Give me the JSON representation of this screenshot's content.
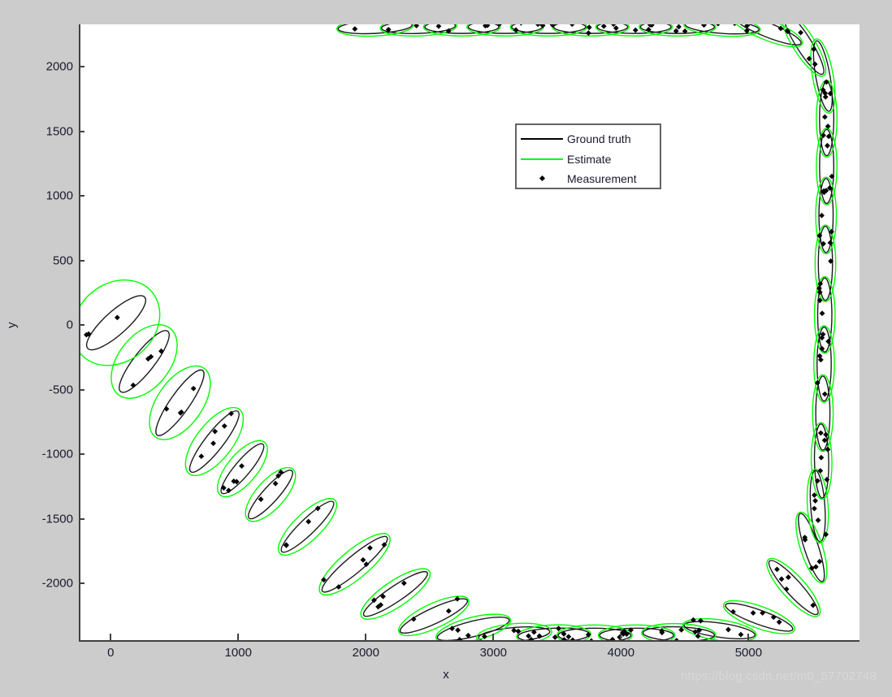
{
  "figure": {
    "background_color": "#cccccc",
    "plot_background_color": "#ffffff",
    "axis_color": "#404040"
  },
  "axes": {
    "xlabel": "x",
    "ylabel": "y",
    "xticks": [
      "0",
      "1000",
      "2000",
      "3000",
      "4000",
      "5000"
    ],
    "yticks": [
      "2000",
      "1500",
      "1000",
      "500",
      "0",
      "-500",
      "-1000",
      "-1500",
      "-2000"
    ]
  },
  "legend": {
    "items": [
      {
        "label": "Ground truth",
        "type": "line",
        "color": "#000000"
      },
      {
        "label": "Estimate",
        "type": "line",
        "color": "#00ff00"
      },
      {
        "label": "Measurement",
        "type": "marker",
        "color": "#000000"
      }
    ]
  },
  "watermark": {
    "text": "https://blog.csdn.net/m0_57702748"
  },
  "chart_data": {
    "type": "scatter",
    "title": "",
    "xlabel": "x",
    "ylabel": "y",
    "xlim": [
      -250,
      5870
    ],
    "ylim": [
      -2450,
      2330
    ],
    "xticks": [
      0,
      1000,
      2000,
      3000,
      4000,
      5000
    ],
    "yticks": [
      2000,
      1500,
      1000,
      500,
      0,
      -500,
      -1000,
      -1500,
      -2000
    ],
    "grid": false,
    "legend_position": "upper-center",
    "series": [
      {
        "name": "Ground truth",
        "color": "#000000",
        "render": "covariance-ellipse"
      },
      {
        "name": "Estimate",
        "color": "#00ff00",
        "render": "covariance-ellipse"
      },
      {
        "name": "Measurement",
        "color": "#000000",
        "render": "diamond-marker"
      }
    ],
    "description": "Rounded-rectangle target trajectory traversed counter-clockwise from upper-left start, down the left diagonal, along the bottom to the right, then up the right side and across the top. Each time step draws a black ground-truth covariance ellipse, a green estimate covariance ellipse, and clustered black diamond measurement points.",
    "steps": [
      {
        "i": 0,
        "x": 30,
        "y": 20,
        "truth_rx": 300,
        "truth_ry": 90,
        "est_rx": 370,
        "est_ry": 300,
        "angle": 42,
        "n_meas": 3
      },
      {
        "i": 1,
        "x": 250,
        "y": -280,
        "truth_rx": 300,
        "truth_ry": 80,
        "est_rx": 330,
        "est_ry": 200,
        "angle": 52,
        "n_meas": 4
      },
      {
        "i": 2,
        "x": 530,
        "y": -600,
        "truth_rx": 310,
        "truth_ry": 75,
        "est_rx": 330,
        "est_ry": 175,
        "angle": 55,
        "n_meas": 4
      },
      {
        "i": 3,
        "x": 800,
        "y": -900,
        "truth_rx": 300,
        "truth_ry": 70,
        "est_rx": 320,
        "est_ry": 140,
        "angle": 52,
        "n_meas": 5
      },
      {
        "i": 4,
        "x": 1020,
        "y": -1110,
        "truth_rx": 250,
        "truth_ry": 60,
        "est_rx": 270,
        "est_ry": 115,
        "angle": 50,
        "n_meas": 5
      },
      {
        "i": 5,
        "x": 1240,
        "y": -1310,
        "truth_rx": 250,
        "truth_ry": 60,
        "est_rx": 265,
        "est_ry": 110,
        "angle": 48,
        "n_meas": 4
      },
      {
        "i": 6,
        "x": 1530,
        "y": -1560,
        "truth_rx": 280,
        "truth_ry": 60,
        "est_rx": 300,
        "est_ry": 105,
        "angle": 44,
        "n_meas": 4
      },
      {
        "i": 7,
        "x": 1900,
        "y": -1850,
        "truth_rx": 330,
        "truth_ry": 65,
        "est_rx": 350,
        "est_ry": 110,
        "angle": 40,
        "n_meas": 6
      },
      {
        "i": 8,
        "x": 2220,
        "y": -2080,
        "truth_rx": 300,
        "truth_ry": 60,
        "est_rx": 320,
        "est_ry": 100,
        "angle": 34,
        "n_meas": 5
      },
      {
        "i": 9,
        "x": 2520,
        "y": -2250,
        "truth_rx": 290,
        "truth_ry": 60,
        "est_rx": 300,
        "est_ry": 95,
        "angle": 25,
        "n_meas": 3
      },
      {
        "i": 10,
        "x": 2830,
        "y": -2350,
        "truth_rx": 290,
        "truth_ry": 60,
        "est_rx": 300,
        "est_ry": 90,
        "angle": 14,
        "n_meas": 5
      },
      {
        "i": 11,
        "x": 3150,
        "y": -2395,
        "truth_rx": 280,
        "truth_ry": 55,
        "est_rx": 295,
        "est_ry": 85,
        "angle": 5,
        "n_meas": 5
      },
      {
        "i": 12,
        "x": 3460,
        "y": -2400,
        "truth_rx": 280,
        "truth_ry": 55,
        "est_rx": 290,
        "est_ry": 80,
        "angle": 2,
        "n_meas": 6
      },
      {
        "i": 13,
        "x": 3780,
        "y": -2400,
        "truth_rx": 285,
        "truth_ry": 55,
        "est_rx": 295,
        "est_ry": 80,
        "angle": 0,
        "n_meas": 6
      },
      {
        "i": 14,
        "x": 4110,
        "y": -2400,
        "truth_rx": 290,
        "truth_ry": 55,
        "est_rx": 300,
        "est_ry": 80,
        "angle": 0,
        "n_meas": 6
      },
      {
        "i": 15,
        "x": 4440,
        "y": -2390,
        "truth_rx": 280,
        "truth_ry": 55,
        "est_rx": 290,
        "est_ry": 80,
        "angle": -2,
        "n_meas": 5
      },
      {
        "i": 16,
        "x": 4760,
        "y": -2360,
        "truth_rx": 280,
        "truth_ry": 55,
        "est_rx": 290,
        "est_ry": 80,
        "angle": -8,
        "n_meas": 5
      },
      {
        "i": 17,
        "x": 5070,
        "y": -2260,
        "truth_rx": 280,
        "truth_ry": 55,
        "est_rx": 295,
        "est_ry": 85,
        "angle": -20,
        "n_meas": 5
      },
      {
        "i": 18,
        "x": 5340,
        "y": -2030,
        "truth_rx": 280,
        "truth_ry": 60,
        "est_rx": 295,
        "est_ry": 90,
        "angle": -48,
        "n_meas": 5
      },
      {
        "i": 19,
        "x": 5480,
        "y": -1720,
        "truth_rx": 280,
        "truth_ry": 55,
        "est_rx": 290,
        "est_ry": 85,
        "angle": -72,
        "n_meas": 5
      },
      {
        "i": 20,
        "x": 5530,
        "y": -1400,
        "truth_rx": 280,
        "truth_ry": 55,
        "est_rx": 290,
        "est_ry": 80,
        "angle": -86,
        "n_meas": 5
      },
      {
        "i": 21,
        "x": 5560,
        "y": -1050,
        "truth_rx": 290,
        "truth_ry": 55,
        "est_rx": 300,
        "est_ry": 80,
        "angle": -89,
        "n_meas": 5
      },
      {
        "i": 22,
        "x": 5570,
        "y": -680,
        "truth_rx": 290,
        "truth_ry": 55,
        "est_rx": 300,
        "est_ry": 80,
        "angle": -90,
        "n_meas": 4
      },
      {
        "i": 23,
        "x": 5580,
        "y": -300,
        "truth_rx": 290,
        "truth_ry": 55,
        "est_rx": 300,
        "est_ry": 80,
        "angle": -90,
        "n_meas": 5
      },
      {
        "i": 24,
        "x": 5585,
        "y": 80,
        "truth_rx": 290,
        "truth_ry": 55,
        "est_rx": 300,
        "est_ry": 80,
        "angle": -90,
        "n_meas": 5
      },
      {
        "i": 25,
        "x": 5590,
        "y": 480,
        "truth_rx": 290,
        "truth_ry": 55,
        "est_rx": 300,
        "est_ry": 80,
        "angle": -90,
        "n_meas": 5
      },
      {
        "i": 26,
        "x": 5595,
        "y": 850,
        "truth_rx": 290,
        "truth_ry": 55,
        "est_rx": 300,
        "est_ry": 80,
        "angle": -90,
        "n_meas": 5
      },
      {
        "i": 27,
        "x": 5600,
        "y": 1230,
        "truth_rx": 290,
        "truth_ry": 55,
        "est_rx": 300,
        "est_ry": 80,
        "angle": -90,
        "n_meas": 5
      },
      {
        "i": 28,
        "x": 5600,
        "y": 1600,
        "truth_rx": 290,
        "truth_ry": 55,
        "est_rx": 300,
        "est_ry": 80,
        "angle": -90,
        "n_meas": 5
      },
      {
        "i": 29,
        "x": 5570,
        "y": 1930,
        "truth_rx": 280,
        "truth_ry": 55,
        "est_rx": 295,
        "est_ry": 80,
        "angle": -80,
        "n_meas": 4
      },
      {
        "i": 30,
        "x": 5420,
        "y": 2180,
        "truth_rx": 280,
        "truth_ry": 60,
        "est_rx": 295,
        "est_ry": 85,
        "angle": -58,
        "n_meas": 4
      },
      {
        "i": 31,
        "x": 5130,
        "y": 2290,
        "truth_rx": 290,
        "truth_ry": 55,
        "est_rx": 300,
        "est_ry": 80,
        "angle": -22,
        "n_meas": 3
      },
      {
        "i": 32,
        "x": 4780,
        "y": 2310,
        "truth_rx": 290,
        "truth_ry": 50,
        "est_rx": 300,
        "est_ry": 70,
        "angle": -4,
        "n_meas": 4
      },
      {
        "i": 33,
        "x": 4430,
        "y": 2310,
        "truth_rx": 290,
        "truth_ry": 50,
        "est_rx": 300,
        "est_ry": 70,
        "angle": 0,
        "n_meas": 5
      },
      {
        "i": 34,
        "x": 4090,
        "y": 2310,
        "truth_rx": 290,
        "truth_ry": 50,
        "est_rx": 300,
        "est_ry": 70,
        "angle": 0,
        "n_meas": 5
      },
      {
        "i": 35,
        "x": 3750,
        "y": 2310,
        "truth_rx": 290,
        "truth_ry": 50,
        "est_rx": 300,
        "est_ry": 70,
        "angle": 0,
        "n_meas": 5
      },
      {
        "i": 36,
        "x": 3420,
        "y": 2310,
        "truth_rx": 290,
        "truth_ry": 50,
        "est_rx": 300,
        "est_ry": 70,
        "angle": 0,
        "n_meas": 4
      },
      {
        "i": 37,
        "x": 3080,
        "y": 2310,
        "truth_rx": 290,
        "truth_ry": 50,
        "est_rx": 300,
        "est_ry": 70,
        "angle": 0,
        "n_meas": 4
      },
      {
        "i": 38,
        "x": 2740,
        "y": 2310,
        "truth_rx": 290,
        "truth_ry": 50,
        "est_rx": 300,
        "est_ry": 70,
        "angle": 0,
        "n_meas": 3
      },
      {
        "i": 39,
        "x": 2400,
        "y": 2310,
        "truth_rx": 290,
        "truth_ry": 50,
        "est_rx": 300,
        "est_ry": 70,
        "angle": 2,
        "n_meas": 3
      },
      {
        "i": 40,
        "x": 2060,
        "y": 2310,
        "truth_rx": 290,
        "truth_ry": 50,
        "est_rx": 300,
        "est_ry": 70,
        "angle": 3,
        "n_meas": 2
      }
    ]
  }
}
